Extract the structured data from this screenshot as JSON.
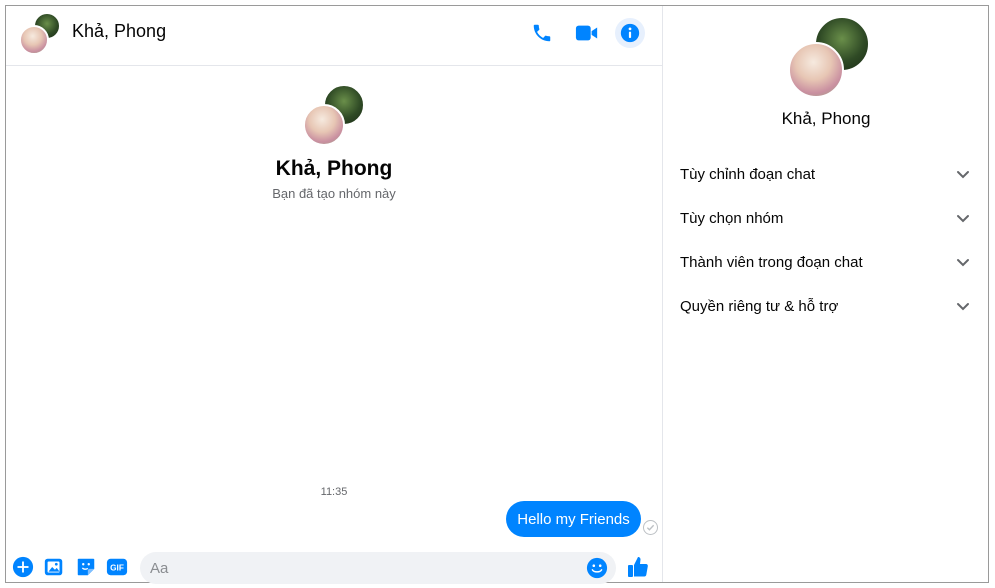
{
  "header": {
    "title": "Khả, Phong",
    "call_icon": "phone-icon",
    "video_icon": "video-camera-icon",
    "info_icon": "info-icon"
  },
  "conversation": {
    "name": "Khả, Phong",
    "subtitle": "Bạn đã tạo nhóm này",
    "timestamp": "11:35",
    "messages": [
      {
        "text": "Hello my Friends",
        "from": "me"
      }
    ]
  },
  "composer": {
    "placeholder": "Aa",
    "value": "",
    "icons": [
      "plus-circle-icon",
      "photo-icon",
      "sticker-icon",
      "gif-icon",
      "emoji-icon",
      "thumbs-up-icon"
    ]
  },
  "sidebar": {
    "name": "Khả, Phong",
    "items": [
      {
        "label": "Tùy chỉnh đoạn chat"
      },
      {
        "label": "Tùy chọn nhóm"
      },
      {
        "label": "Thành viên trong đoạn chat"
      },
      {
        "label": "Quyền riêng tư & hỗ trợ"
      }
    ]
  },
  "colors": {
    "accent": "#0084ff",
    "info_button_bg": "#e7f0fd",
    "input_bg": "#f0f2f5",
    "muted_text": "#65676b"
  }
}
